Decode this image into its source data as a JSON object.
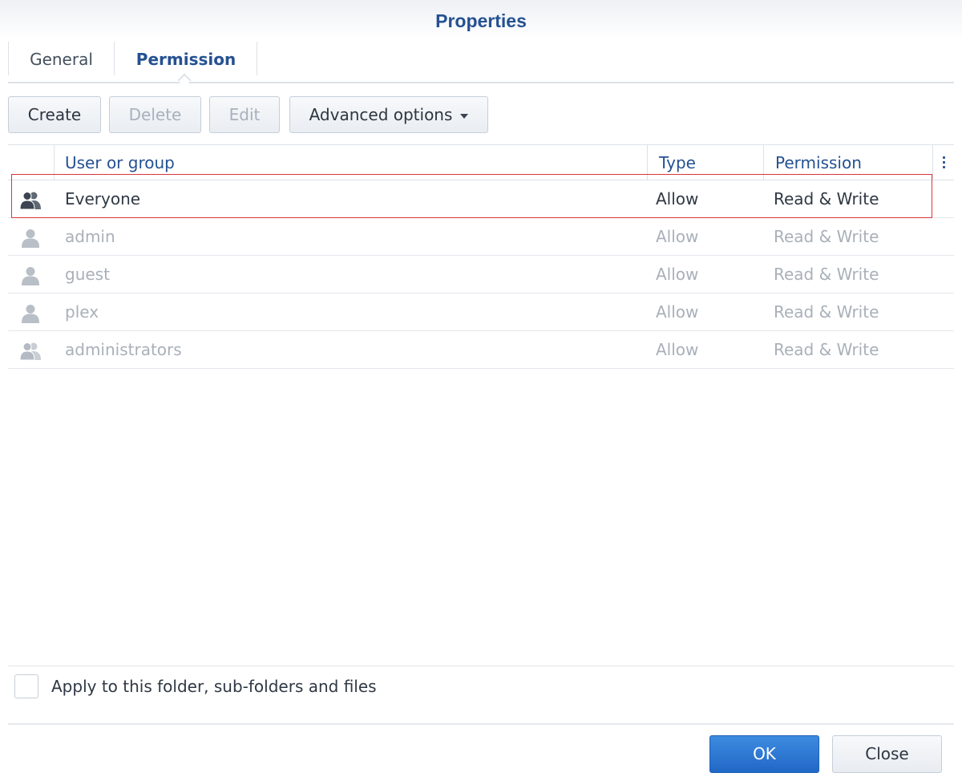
{
  "window": {
    "title": "Properties"
  },
  "tabs": [
    {
      "label": "General",
      "active": false
    },
    {
      "label": "Permission",
      "active": true
    }
  ],
  "toolbar": {
    "create_label": "Create",
    "delete_label": "Delete",
    "edit_label": "Edit",
    "advanced_label": "Advanced options"
  },
  "table": {
    "columns": [
      "User or group",
      "Type",
      "Permission"
    ],
    "rows": [
      {
        "icon": "group-icon",
        "name": "Everyone",
        "type": "Allow",
        "permission": "Read & Write",
        "highlighted": true
      },
      {
        "icon": "user-icon",
        "name": "admin",
        "type": "Allow",
        "permission": "Read & Write"
      },
      {
        "icon": "user-icon",
        "name": "guest",
        "type": "Allow",
        "permission": "Read & Write"
      },
      {
        "icon": "user-icon",
        "name": "plex",
        "type": "Allow",
        "permission": "Read & Write"
      },
      {
        "icon": "group-icon",
        "name": "administrators",
        "type": "Allow",
        "permission": "Read & Write"
      }
    ]
  },
  "apply_checkbox": {
    "label": "Apply to this folder, sub-folders and files",
    "checked": false
  },
  "footer": {
    "ok_label": "OK",
    "close_label": "Close"
  },
  "colors": {
    "accent": "#255191",
    "primary_button": "#2a75d4",
    "highlight_border": "#d9363e"
  }
}
